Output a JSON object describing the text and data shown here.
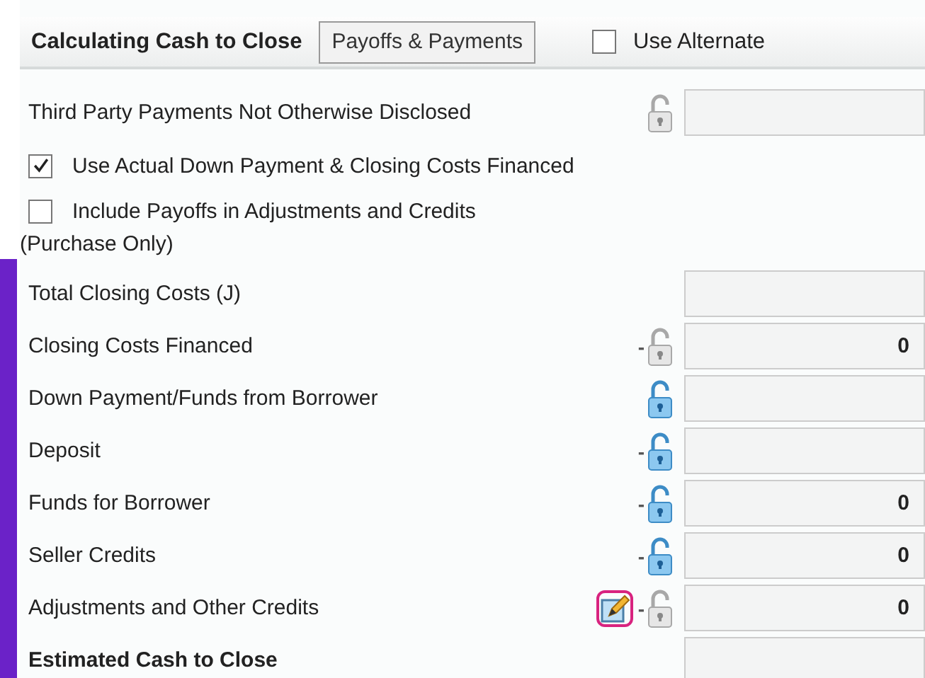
{
  "header": {
    "title": "Calculating Cash to Close",
    "button": "Payoffs & Payments",
    "alternate": {
      "label": "Use Alternate",
      "checked": false
    }
  },
  "rows": [
    {
      "kind": "field",
      "label": "Third Party Payments Not Otherwise Disclosed",
      "lock": {
        "active": false
      },
      "value": ""
    },
    {
      "kind": "checkbox",
      "label": "Use Actual Down Payment & Closing Costs Financed",
      "checked": true
    },
    {
      "kind": "checkbox",
      "label": "Include Payoffs in Adjustments and Credits",
      "continuation": "(Purchase Only)",
      "checked": false
    },
    {
      "kind": "field",
      "label": "Total Closing Costs (J)",
      "value": ""
    },
    {
      "kind": "field",
      "label": "Closing Costs Financed",
      "sign": "-",
      "lock": {
        "active": false
      },
      "value": "0"
    },
    {
      "kind": "field",
      "label": "Down Payment/Funds from Borrower",
      "lock": {
        "active": true
      },
      "value": ""
    },
    {
      "kind": "field",
      "label": "Deposit",
      "sign": "-",
      "lock": {
        "active": true
      },
      "value": ""
    },
    {
      "kind": "field",
      "label": "Funds for Borrower",
      "sign": "-",
      "lock": {
        "active": true
      },
      "value": "0"
    },
    {
      "kind": "field",
      "label": "Seller Credits",
      "sign": "-",
      "lock": {
        "active": true
      },
      "value": "0"
    },
    {
      "kind": "field",
      "label": "Adjustments and Other Credits",
      "edit": {
        "highlighted": true
      },
      "sign": "-",
      "lock": {
        "active": false
      },
      "value": "0"
    },
    {
      "kind": "field",
      "label": "Estimated Cash to Close",
      "emphasis": true,
      "value": ""
    }
  ]
}
